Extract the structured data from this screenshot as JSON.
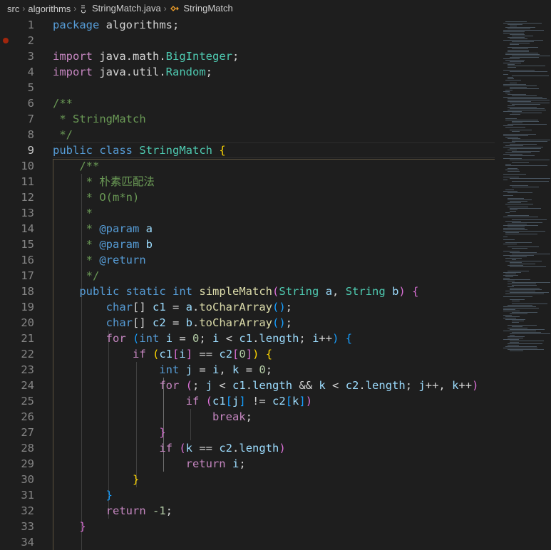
{
  "breadcrumb": {
    "root": "src",
    "package": "algorithms",
    "file": "StringMatch.java",
    "symbol": "StringMatch"
  },
  "line_numbers": [
    "1",
    "2",
    "3",
    "4",
    "5",
    "6",
    "7",
    "8",
    "9",
    "10",
    "11",
    "12",
    "13",
    "14",
    "15",
    "16",
    "17",
    "18",
    "19",
    "20",
    "21",
    "22",
    "23",
    "24",
    "25",
    "26",
    "27",
    "28",
    "29",
    "30",
    "31",
    "32",
    "33",
    "34"
  ],
  "code": {
    "l1": {
      "t1": "package",
      "t2": " algorithms;"
    },
    "l3": {
      "t1": "import",
      "t2": " java.",
      "t3": "math",
      "t4": ".",
      "t5": "BigInteger",
      ";": ";"
    },
    "l4": {
      "t1": "import",
      "t2": " java.",
      "t3": "util",
      "t4": ".",
      "t5": "Random",
      ";": ";"
    },
    "l6": {
      "t1": "/**"
    },
    "l7": {
      "t1": " * StringMatch"
    },
    "l8": {
      "t1": " */"
    },
    "l9": {
      "t1": "public",
      "t2": " ",
      "t3": "class",
      "t4": " ",
      "t5": "StringMatch",
      "t6": " ",
      "t7": "{"
    },
    "l10": {
      "t1": "    /**"
    },
    "l11": {
      "t1": "     * 朴素匹配法"
    },
    "l12": {
      "t1": "     * O(m*n)"
    },
    "l13": {
      "t1": "     *"
    },
    "l14": {
      "t1": "     * ",
      "t2": "@param",
      "t3": " ",
      "t4": "a"
    },
    "l15": {
      "t1": "     * ",
      "t2": "@param",
      "t3": " ",
      "t4": "b"
    },
    "l16": {
      "t1": "     * ",
      "t2": "@return"
    },
    "l17": {
      "t1": "     */"
    },
    "l18": {
      "t1": "public",
      "t2": "static",
      "t3": "int",
      "t4": "simpleMatch",
      "t5": "(",
      "t6": "String",
      "t7": "a",
      "t8": "String",
      "t9": "b",
      "t10": ")",
      "t11": "{"
    },
    "l19": {
      "t1": "char",
      "t2": "[] ",
      "t3": "c1",
      "t4": " = ",
      "t5": "a",
      "t6": ".",
      "t7": "toCharArray",
      "t8": "()",
      ";": ";"
    },
    "l20": {
      "t1": "char",
      "t2": "[] ",
      "t3": "c2",
      "t4": " = ",
      "t5": "b",
      "t6": ".",
      "t7": "toCharArray",
      "t8": "()",
      ";": ";"
    },
    "l21": {
      "t1": "for",
      "t2": "(",
      "t3": "int",
      "t4": "i",
      "t5": "0",
      "t6": "i",
      "t7": "c1",
      "t8": "length",
      "t9": "i",
      "t10": ")",
      "t11": "{"
    },
    "l22": {
      "t1": "if",
      "t2": "(",
      "t3": "c1",
      "t4": "[",
      "t5": "i",
      "t6": "]",
      "t7": "c2",
      "t8": "[",
      "t9": "0",
      "t10": "]",
      "t11": ")",
      "t12": "{"
    },
    "l23": {
      "t1": "int",
      "t2": "j",
      "t3": "i",
      "t4": "k",
      "t5": "0"
    },
    "l24": {
      "t1": "for",
      "t2": "(",
      "t3": "j",
      "t4": "c1",
      "t5": "length",
      "t6": "k",
      "t7": "c2",
      "t8": "length",
      "t9": "j",
      "t10": "k",
      "t11": ")"
    },
    "l25": {
      "t1": "if",
      "t2": "(",
      "t3": "c1",
      "t4": "[",
      "t5": "j",
      "t6": "]",
      "t7": "c2",
      "t8": "[",
      "t9": "k",
      "t10": "]",
      "t11": ")"
    },
    "l26": {
      "t1": "break"
    },
    "l27": {
      "t1": "}"
    },
    "l28": {
      "t1": "if",
      "t2": "(",
      "t3": "k",
      "t4": "c2",
      "t5": "length",
      "t6": ")"
    },
    "l29": {
      "t1": "return",
      "t2": "i"
    },
    "l30": {
      "t1": "}"
    },
    "l31": {
      "t1": "}"
    },
    "l32": {
      "t1": "return",
      "t2": "-1"
    },
    "l33": {
      "t1": "}"
    }
  },
  "colors": {
    "keyword": "#569cd6",
    "control": "#c586c0",
    "type": "#4ec9b0",
    "function": "#dcdcaa",
    "variable": "#9cdcfe",
    "number": "#b5cea8",
    "comment": "#6a9955",
    "bracket1": "#ffd700",
    "bracket2": "#da70d6",
    "bracket3": "#179fff",
    "background": "#1e1e1e"
  },
  "icons": {
    "file": "java-file-icon",
    "symbol": "class-symbol-icon",
    "breakpoint": "breakpoint-icon"
  }
}
